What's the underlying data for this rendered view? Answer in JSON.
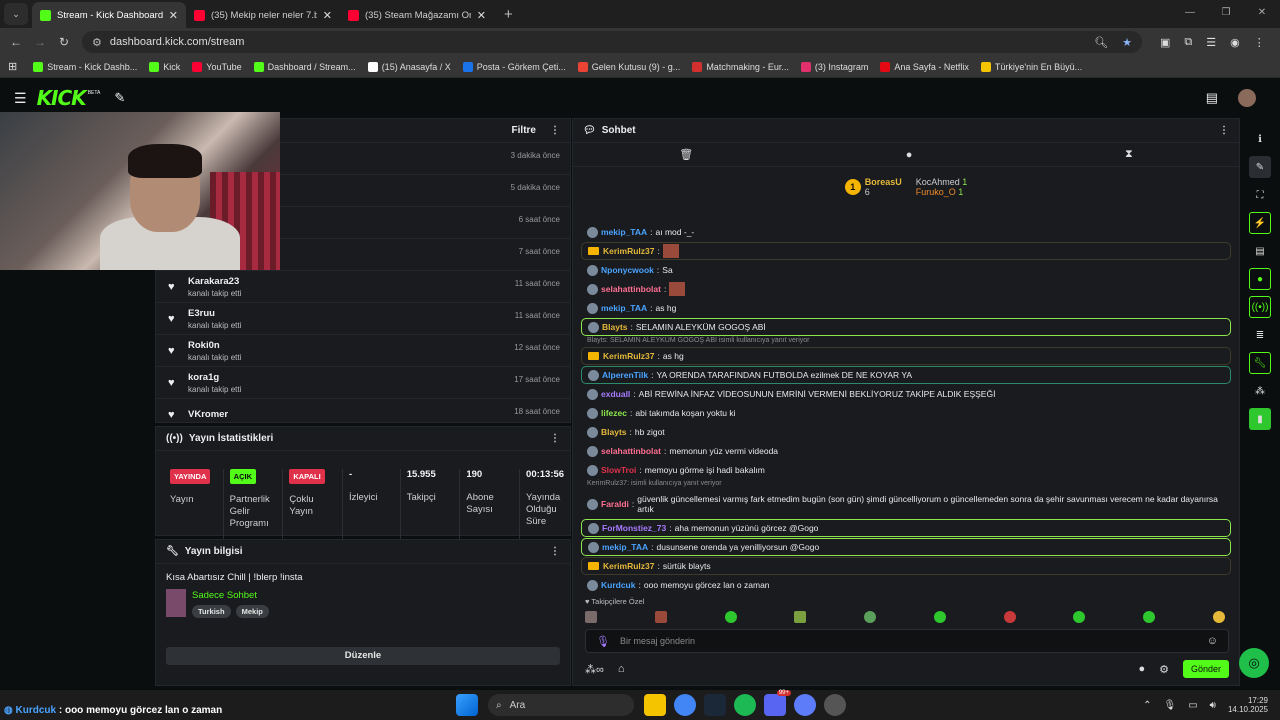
{
  "browser": {
    "tabs": [
      {
        "title": "Stream - Kick Dashboard",
        "color": "#53fc18",
        "active": true
      },
      {
        "title": "(35) Mekip neler neler 7.bölüm",
        "color": "#ff0033",
        "active": false
      },
      {
        "title": "(35) Steam Mağazamı Onayla A",
        "color": "#ff0033",
        "active": false
      }
    ],
    "url": "dashboard.kick.com/stream",
    "bookmarks": [
      {
        "label": "Stream - Kick Dashb...",
        "color": "#53fc18"
      },
      {
        "label": "Kick",
        "color": "#53fc18"
      },
      {
        "label": "YouTube",
        "color": "#ff0033"
      },
      {
        "label": "Dashboard / Stream...",
        "color": "#53fc18"
      },
      {
        "label": "(15) Anasayfa / X",
        "color": "#ffffff"
      },
      {
        "label": "Posta - Görkem Çeti...",
        "color": "#1a73e8"
      },
      {
        "label": "Gelen Kutusu (9) - g...",
        "color": "#ea4335"
      },
      {
        "label": "Matchmaking - Eur...",
        "color": "#d32f2f"
      },
      {
        "label": "(3) Instagram",
        "color": "#e1306c"
      },
      {
        "label": "Ana Sayfa - Netflix",
        "color": "#e50914"
      },
      {
        "label": "Türkiye'nin En Büyü...",
        "color": "#f5c400"
      }
    ]
  },
  "kick": {
    "logo": "KICK",
    "beta": "BETA"
  },
  "activity": {
    "filter_label": "Filtre",
    "items": [
      {
        "name": "",
        "sub": "",
        "ago": "3 dakika önce"
      },
      {
        "name": "",
        "sub": "",
        "ago": "5 dakika önce"
      },
      {
        "name": "",
        "sub": "",
        "ago": "6 saat önce"
      },
      {
        "name": "",
        "sub": "",
        "ago": "7 saat önce"
      },
      {
        "name": "Karakara23",
        "sub": "kanalı takip etti",
        "ago": "11 saat önce"
      },
      {
        "name": "E3ruu",
        "sub": "kanalı takip etti",
        "ago": "11 saat önce"
      },
      {
        "name": "Roki0n",
        "sub": "kanalı takip etti",
        "ago": "12 saat önce"
      },
      {
        "name": "kora1g",
        "sub": "kanalı takip etti",
        "ago": "17 saat önce"
      },
      {
        "name": "VKromer",
        "sub": "",
        "ago": "18 saat önce"
      }
    ]
  },
  "stream_stats": {
    "title": "Yayın İstatistikleri",
    "cols": [
      {
        "badge": "YAYINDA",
        "badge_bg": "#e0314b",
        "badge_fg": "#ffffff",
        "value": "",
        "label": "Yayın"
      },
      {
        "badge": "AÇIK",
        "badge_bg": "#53fc18",
        "badge_fg": "#0b0e0f",
        "value": "",
        "label": "Partnerlik Gelir Programı"
      },
      {
        "badge": "KAPALI",
        "badge_bg": "#e0314b",
        "badge_fg": "#ffffff",
        "value": "",
        "label": "Çoklu Yayın"
      },
      {
        "badge": "",
        "value": "-",
        "label": "İzleyici"
      },
      {
        "badge": "",
        "value": "15.955",
        "label": "Takipçi"
      },
      {
        "badge": "",
        "value": "190",
        "label": "Abone Sayısı"
      },
      {
        "badge": "",
        "value": "00:13:56",
        "label": "Yayında Olduğu Süre"
      }
    ]
  },
  "stream_info": {
    "title": "Yayın bilgisi",
    "stream_title": "Kısa Abartısız Chill | !blerp !insta",
    "category": "Sadece Sohbet",
    "tags": [
      "Turkish",
      "Mekip"
    ],
    "edit_label": "Düzenle"
  },
  "chat": {
    "title": "Sohbet",
    "top": [
      {
        "rank": "1",
        "name": "BoreasU",
        "count": "6"
      },
      {
        "rank": "",
        "name": "KocAhmed",
        "count": "1"
      },
      {
        "rank": "",
        "name": "Furuko_O",
        "count": "1"
      }
    ],
    "messages": [
      {
        "user": "mekip_TAA",
        "color": "#4aa3ff",
        "text": "aı mod -_-",
        "hl": "",
        "reply": ""
      },
      {
        "user": "KerimRulz37",
        "color": "#e5b83a",
        "text": "",
        "hl": "gold",
        "reply": ""
      },
      {
        "user": "Nponycwook",
        "color": "#4aa3ff",
        "text": "Sa",
        "hl": "",
        "reply": ""
      },
      {
        "user": "selahattinbolat",
        "color": "#ff6f91",
        "text": "",
        "hl": "",
        "reply": ""
      },
      {
        "user": "mekip_TAA",
        "color": "#4aa3ff",
        "text": "as hg",
        "hl": "",
        "reply": ""
      },
      {
        "user": "Blayts",
        "color": "#e5b83a",
        "text": "SELAMIN ALEYKÜM GOGOŞ ABİ",
        "hl": "green",
        "reply": ""
      },
      {
        "user": "KerimRulz37",
        "color": "#e5b83a",
        "text": "as hg",
        "hl": "gold",
        "reply": "Blayts: SELAMIN ALEYKÜM GOGOŞ ABİ isimli kullanıcıya yanıt veriyor"
      },
      {
        "user": "AlperenTilk",
        "color": "#4aa3ff",
        "text": "YA ORENDA TARAFINDAN FUTBOLDA ezilmek DE NE KOYAR YA",
        "hl": "teal",
        "reply": ""
      },
      {
        "user": "exduall",
        "color": "#a77bff",
        "text": "ABİ REWİNA İNFAZ VİDEOSUNUN EMRİNİ VERMENİ BEKLİYORUZ TAKİPE ALDIK EŞŞEĞİ",
        "hl": "",
        "reply": ""
      },
      {
        "user": "lifezec",
        "color": "#8ee64d",
        "text": "abi takımda koşan yoktu ki",
        "hl": "",
        "reply": ""
      },
      {
        "user": "Blayts",
        "color": "#e5b83a",
        "text": "hb zigot",
        "hl": "",
        "reply": ""
      },
      {
        "user": "selahattinbolat",
        "color": "#ff6f91",
        "text": "memonun yüz vermi videoda",
        "hl": "",
        "reply": ""
      },
      {
        "user": "SlowTroi",
        "color": "#e0314b",
        "text": "memoyu görme işi hadi bakalım",
        "hl": "",
        "reply": ""
      },
      {
        "user": "Faraldi",
        "color": "#ff6f91",
        "text": "güvenlik güncellemesi varmış fark etmedim bugün (son gün) şimdi güncelliyorum o güncellemeden sonra da şehir savunması verecem ne kadar dayanırsa artık",
        "hl": "",
        "reply": "KerimRulz37: isimli kullanıcıya yanıt veriyor"
      },
      {
        "user": "ForMonstiez_73",
        "color": "#a77bff",
        "text": "aha memonun yüzünü görcez @Gogo",
        "hl": "green",
        "reply": ""
      },
      {
        "user": "mekip_TAA",
        "color": "#4aa3ff",
        "text": "dusunsene orenda ya yenilliyorsun @Gogo",
        "hl": "green",
        "reply": ""
      },
      {
        "user": "KerimRulz37",
        "color": "#e5b83a",
        "text": "sürtük blayts",
        "hl": "gold",
        "reply": ""
      },
      {
        "user": "Kurdcuk",
        "color": "#4aa3ff",
        "text": "ooo memoyu görcez lan o zaman",
        "hl": "",
        "reply": ""
      }
    ],
    "followers_only": "Takipçilere Özel",
    "input_placeholder": "Bir mesaj gönderin",
    "send_label": "Gönder"
  },
  "overlay_caption": {
    "user": "Kurdcuk",
    "text": "ooo memoyu görcez lan o zaman"
  },
  "taskbar": {
    "search": "Ara",
    "time": "17:29",
    "date": "14.10.2025",
    "badge": "99+"
  }
}
